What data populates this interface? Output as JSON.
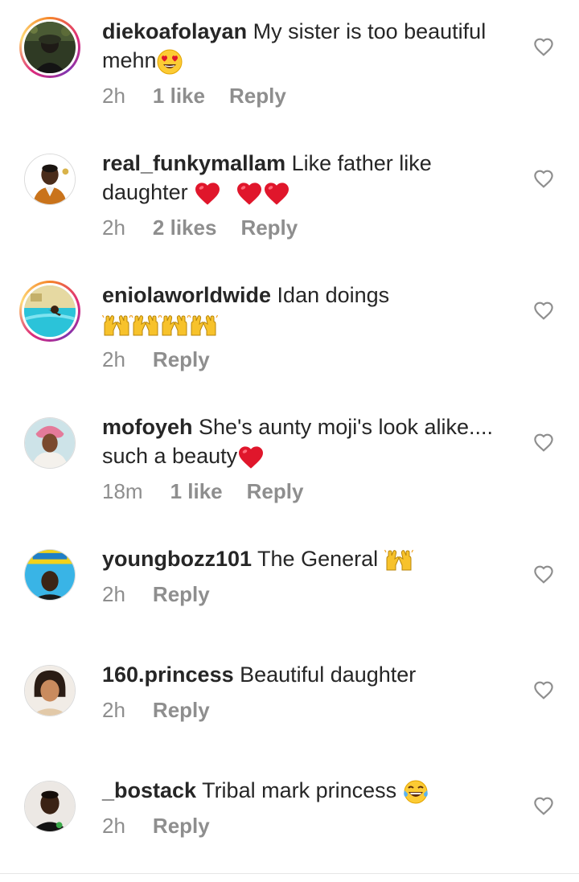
{
  "comments": [
    {
      "username": "diekoafolayan",
      "text": "My sister is too beautiful mehn",
      "emoji": "heart-eyes",
      "time": "2h",
      "likes": "1 like",
      "reply": "Reply",
      "story_ring": true
    },
    {
      "username": "real_funkymallam",
      "text": "Like father like daughter",
      "emoji": "red-hearts",
      "time": "2h",
      "likes": "2 likes",
      "reply": "Reply",
      "story_ring": false
    },
    {
      "username": "eniolaworldwide",
      "text": "Idan doings",
      "emoji": "raised-hands-x5",
      "time": "2h",
      "likes": "",
      "reply": "Reply",
      "story_ring": true
    },
    {
      "username": "mofoyeh",
      "text": "She's aunty moji's look alike.... such a beauty",
      "emoji": "red-heart",
      "time": "18m",
      "likes": "1 like",
      "reply": "Reply",
      "story_ring": false
    },
    {
      "username": "youngbozz101",
      "text": "The General",
      "emoji": "raised-hands",
      "time": "2h",
      "likes": "",
      "reply": "Reply",
      "story_ring": false
    },
    {
      "username": "160.princess",
      "text": "Beautiful daughter",
      "emoji": "",
      "time": "2h",
      "likes": "",
      "reply": "Reply",
      "story_ring": false
    },
    {
      "username": "_bostack",
      "text": "Tribal mark princess",
      "emoji": "tears-of-joy",
      "time": "2h",
      "likes": "",
      "reply": "Reply",
      "story_ring": false
    }
  ],
  "colors": {
    "text": "#262626",
    "meta": "#8e8e8e",
    "heart_outline": "#8e8e8e",
    "emoji_heart": "#e0162b",
    "emoji_yellow": "#f7c22b"
  }
}
